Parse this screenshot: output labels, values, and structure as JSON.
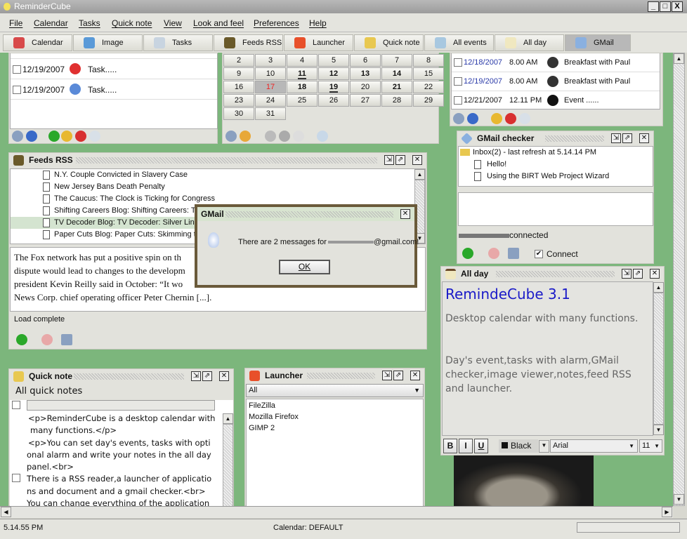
{
  "window": {
    "title": "ReminderCube",
    "controls": [
      "_",
      "□",
      "X"
    ]
  },
  "menu": [
    "File",
    "Calendar",
    "Tasks",
    "Quick note",
    "View",
    "Look and feel",
    "Preferences",
    "Help"
  ],
  "toolbar": [
    {
      "label": "Calendar",
      "color": "#d84a4a"
    },
    {
      "label": "Image",
      "color": "#5a9ad8"
    },
    {
      "label": "Tasks",
      "color": "#c8d4e0"
    },
    {
      "label": "Feeds RSS",
      "color": "#6a5a2a"
    },
    {
      "label": "Launcher",
      "color": "#e8502a"
    },
    {
      "label": "Quick note",
      "color": "#e8c850"
    },
    {
      "label": "All events",
      "color": "#a8c8e0"
    },
    {
      "label": "All day",
      "color": "#f0e8c0"
    },
    {
      "label": "GMail checker",
      "color": "#8ab0e0"
    }
  ],
  "tasks": {
    "rows": [
      {
        "date": "12/19/2007",
        "label": "Task.....",
        "icon": "lifebuoy-icon",
        "color": "#e03030"
      },
      {
        "date": "12/19/2007",
        "label": "Task.....",
        "icon": "cocktail-icon",
        "color": "#5a8ad8"
      }
    ]
  },
  "calendar": {
    "weeks": [
      [
        "2",
        "3",
        "4",
        "5",
        "6",
        "7",
        "8"
      ],
      [
        "9",
        "10",
        "11",
        "12",
        "13",
        "14",
        "15"
      ],
      [
        "16",
        "17",
        "18",
        "19",
        "20",
        "21",
        "22"
      ],
      [
        "23",
        "24",
        "25",
        "26",
        "27",
        "28",
        "29"
      ],
      [
        "30",
        "31"
      ]
    ],
    "bold": [
      "11",
      "12",
      "13",
      "14",
      "18",
      "19",
      "21"
    ],
    "underlined": [
      "11",
      "19"
    ],
    "today": "17"
  },
  "events": {
    "rows": [
      {
        "date": "12/18/2007",
        "time": "8.00 AM",
        "label": "Breakfast with Paul",
        "date_color": "#2a3aa8"
      },
      {
        "date": "12/19/2007",
        "time": "8.00 AM",
        "label": "Breakfast with Paul",
        "date_color": "#2a3aa8"
      },
      {
        "date": "12/21/2007",
        "time": "12.11 PM",
        "label": "Event ......",
        "date_color": "#111"
      }
    ]
  },
  "feeds": {
    "title": "Feeds RSS",
    "items": [
      "N.Y. Couple Convicted in Slavery Case",
      "New Jersey Bans Death Penalty",
      "The Caucus: The Clock is Ticking for Congress",
      "Shifting Careers Blog: Shifting Careers: The",
      "TV Decoder Blog: TV Decoder: Silver Linin",
      "Paper Cuts Blog: Paper Cuts: Skimming the"
    ],
    "article": [
      "The Fox network has put a positive spin on th",
      "dispute would lead to changes to the developm",
      "president Kevin Reilly said in October: “It wo",
      "News Corp. chief operating officer Peter Chernin [...]."
    ],
    "status": "Load complete"
  },
  "dialog": {
    "title": "GMail",
    "message": "There are 2 messages for",
    "email_suffix": "@gmail.com!",
    "ok": "OK"
  },
  "gmail": {
    "title": "GMail checker",
    "inbox": "Inbox(2) - last refresh at 5.14.14 PM",
    "messages": [
      "Hello!",
      "Using the BIRT Web Project Wizard"
    ],
    "status": "connected",
    "connect_label": "Connect",
    "connected": true
  },
  "allday": {
    "title": "All day",
    "heading": "RemindeCube 3.1",
    "para1": "Desktop calendar with many functions.",
    "para2": "Day's event,tasks with alarm,GMail checker,image viewer,notes,feed RSS and launcher.",
    "color": "Black",
    "font": "Arial",
    "size": "11",
    "heading_color": "#1a1ac8"
  },
  "quicknote": {
    "title": "Quick note",
    "header": "All quick notes",
    "lines": [
      "<p>ReminderCube is a desktop calendar with",
      "many functions.</p>",
      "<p>You can set day's events, tasks with opti",
      "onal alarm and write your notes in the all day",
      "panel.<br>",
      "There is a RSS reader,a launcher of applicatio",
      "ns and document and a gmail checker.<br>",
      "You can change everything of the application"
    ]
  },
  "launcher": {
    "title": "Launcher",
    "filter": "All",
    "items": [
      "FileZilla",
      "Mozilla Firefox",
      "GIMP 2"
    ]
  },
  "statusbar": {
    "time": "5.14.55 PM",
    "calendar": "Calendar: DEFAULT",
    "progress": 0
  }
}
